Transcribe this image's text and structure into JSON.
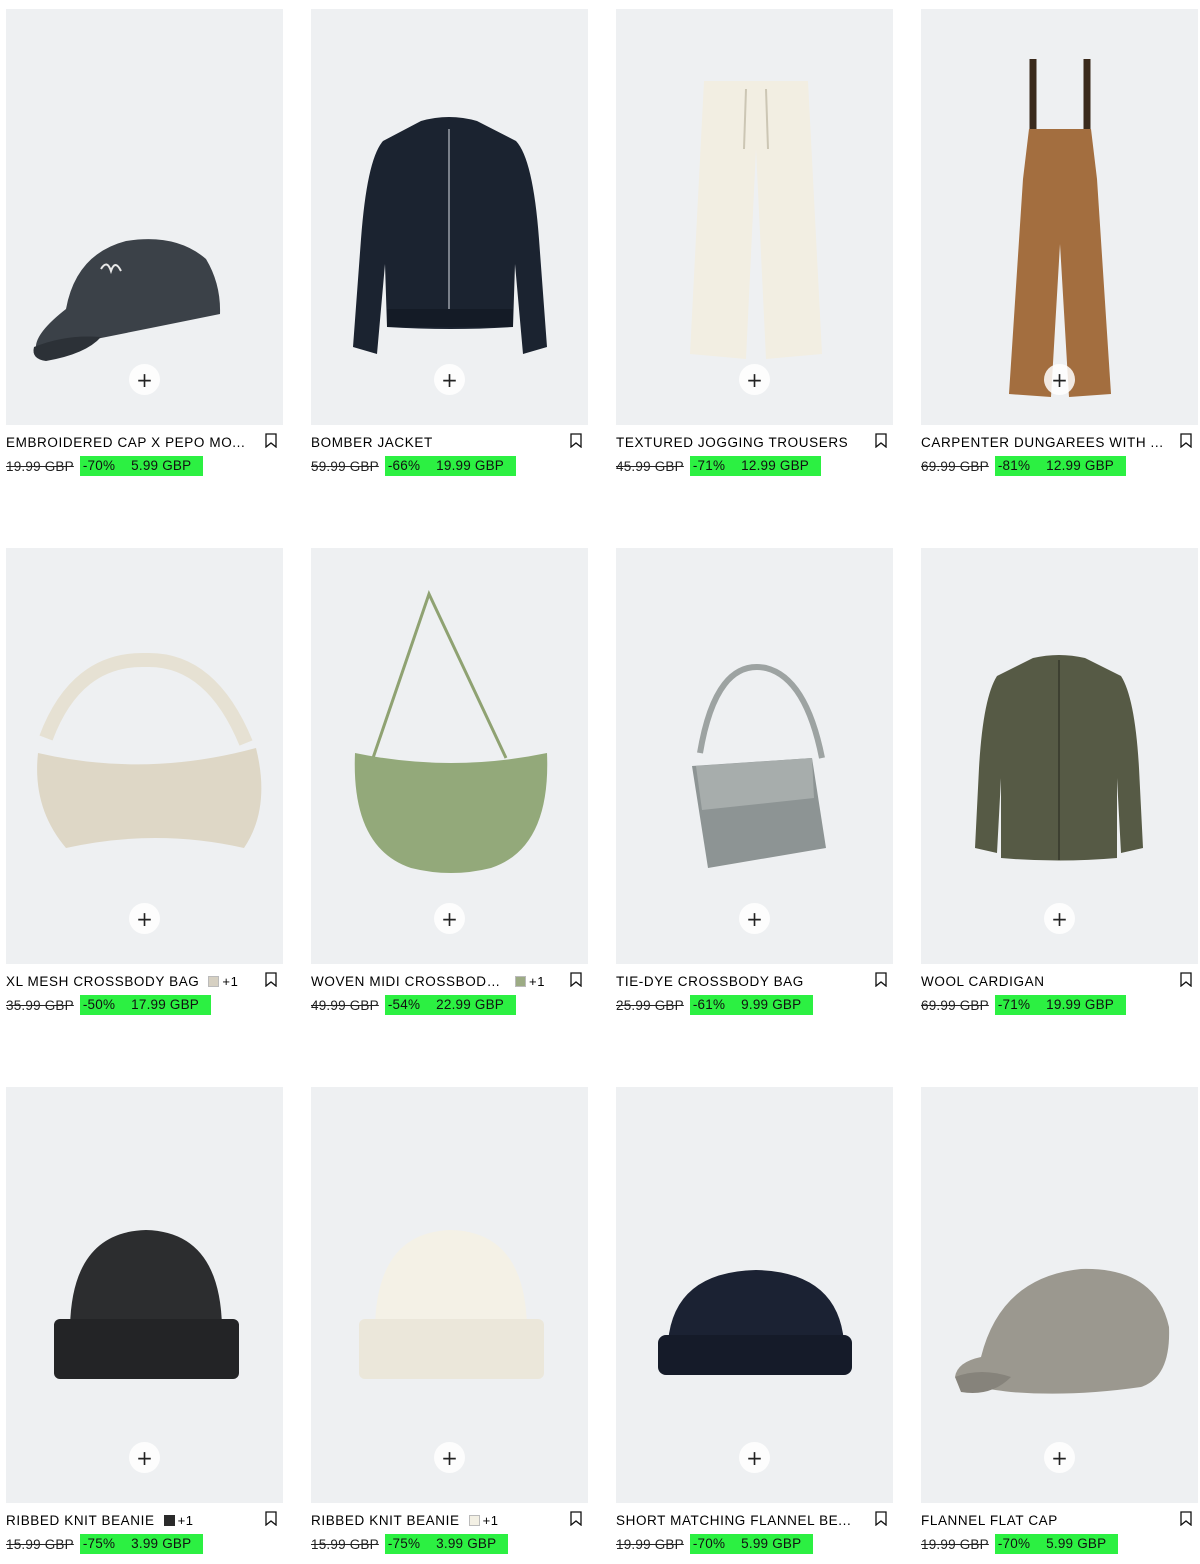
{
  "products": [
    {
      "name": "EMBROIDERED CAP X PEPO MO...",
      "old_price": "19.99 GBP",
      "discount": "-70%",
      "price": "5.99 GBP",
      "icon": "cap-image"
    },
    {
      "name": "BOMBER JACKET",
      "old_price": "59.99 GBP",
      "discount": "-66%",
      "price": "19.99 GBP",
      "icon": "jacket-image"
    },
    {
      "name": "TEXTURED JOGGING TROUSERS",
      "old_price": "45.99 GBP",
      "discount": "-71%",
      "price": "12.99 GBP",
      "icon": "trousers-image"
    },
    {
      "name": "CARPENTER DUNGAREES WITH ...",
      "old_price": "69.99 GBP",
      "discount": "-81%",
      "price": "12.99 GBP",
      "icon": "dungarees-image"
    },
    {
      "name": "XL MESH CROSSBODY BAG",
      "extra_colours": "+1",
      "swatch_color": "#d6d0c2",
      "old_price": "35.99 GBP",
      "discount": "-50%",
      "price": "17.99 GBP",
      "icon": "mesh-bag-image"
    },
    {
      "name": "WOVEN MIDI CROSSBODY ...",
      "extra_colours": "+1",
      "swatch_color": "#9cab84",
      "old_price": "49.99 GBP",
      "discount": "-54%",
      "price": "22.99 GBP",
      "icon": "woven-bag-image"
    },
    {
      "name": "TIE-DYE CROSSBODY BAG",
      "old_price": "25.99 GBP",
      "discount": "-61%",
      "price": "9.99 GBP",
      "icon": "tie-dye-bag-image"
    },
    {
      "name": "WOOL CARDIGAN",
      "old_price": "69.99 GBP",
      "discount": "-71%",
      "price": "19.99 GBP",
      "icon": "cardigan-image"
    },
    {
      "name": "RIBBED KNIT BEANIE",
      "extra_colours": "+1",
      "swatch_color": "#2a2a2a",
      "old_price": "15.99 GBP",
      "discount": "-75%",
      "price": "3.99 GBP",
      "icon": "black-beanie-image"
    },
    {
      "name": "RIBBED KNIT BEANIE",
      "extra_colours": "+1",
      "swatch_color": "#f3f0e4",
      "old_price": "15.99 GBP",
      "discount": "-75%",
      "price": "3.99 GBP",
      "icon": "cream-beanie-image"
    },
    {
      "name": "SHORT MATCHING FLANNEL BE...",
      "old_price": "19.99 GBP",
      "discount": "-70%",
      "price": "5.99 GBP",
      "icon": "navy-beanie-image"
    },
    {
      "name": "FLANNEL FLAT CAP",
      "old_price": "19.99 GBP",
      "discount": "-70%",
      "price": "5.99 GBP",
      "icon": "flat-cap-image"
    }
  ],
  "add_icon": "+",
  "colors": {
    "sale_highlight": "#2cf042",
    "image_bg": "#eef0f2"
  }
}
